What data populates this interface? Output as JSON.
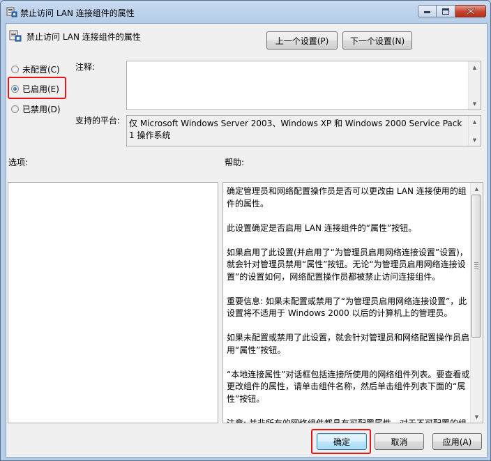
{
  "window": {
    "title": "禁止访问 LAN 连接组件的属性",
    "minimize_icon": "minimize-icon",
    "maximize_icon": "maximize-icon",
    "close_icon": "close-icon"
  },
  "header": {
    "policy_name": "禁止访问 LAN 连接组件的属性",
    "prev_button": "上一个设置(P)",
    "next_button": "下一个设置(N)"
  },
  "state": {
    "options": [
      {
        "label": "未配置(C)",
        "checked": false
      },
      {
        "label": "已启用(E)",
        "checked": true
      },
      {
        "label": "已禁用(D)",
        "checked": false
      }
    ]
  },
  "comment": {
    "label": "注释:",
    "value": ""
  },
  "platform": {
    "label": "支持的平台:",
    "value": "仅 Microsoft Windows Server 2003、Windows XP 和 Windows 2000 Service Pack 1 操作系统"
  },
  "options_panel": {
    "label": "选项:"
  },
  "help_panel": {
    "label": "帮助:",
    "paragraphs": [
      "确定管理员和网络配置操作员是否可以更改由 LAN 连接使用的组件的属性。",
      "此设置确定是否启用 LAN 连接组件的“属性”按钮。",
      "如果启用了此设置(并启用了“为管理员启用网络连接设置”设置)，就会针对管理员禁用“属性”按钮。无论“为管理员启用网络连接设置”的设置如何，网络配置操作员都被禁止访问连接组件。",
      "重要信息: 如果未配置或禁用了“为管理员启用网络连接设置”，此设置将不适用于 Windows 2000 以后的计算机上的管理员。",
      "如果未配置或禁用了此设置，就会针对管理员和网络配置操作员启用“属性”按钮。",
      "“本地连接属性”对话框包括连接所使用的网络组件列表。要查看或更改组件的属性，请单击组件名称，然后单击组件列表下面的“属性”按钮。",
      "注意: 并非所有的网络组件都具有可配置属性。对于不可配置的组"
    ]
  },
  "footer": {
    "ok": "确定",
    "cancel": "取消",
    "apply": "应用(A)"
  },
  "colors": {
    "highlight": "#e8141a",
    "window_frame": "#b9d1ea"
  }
}
